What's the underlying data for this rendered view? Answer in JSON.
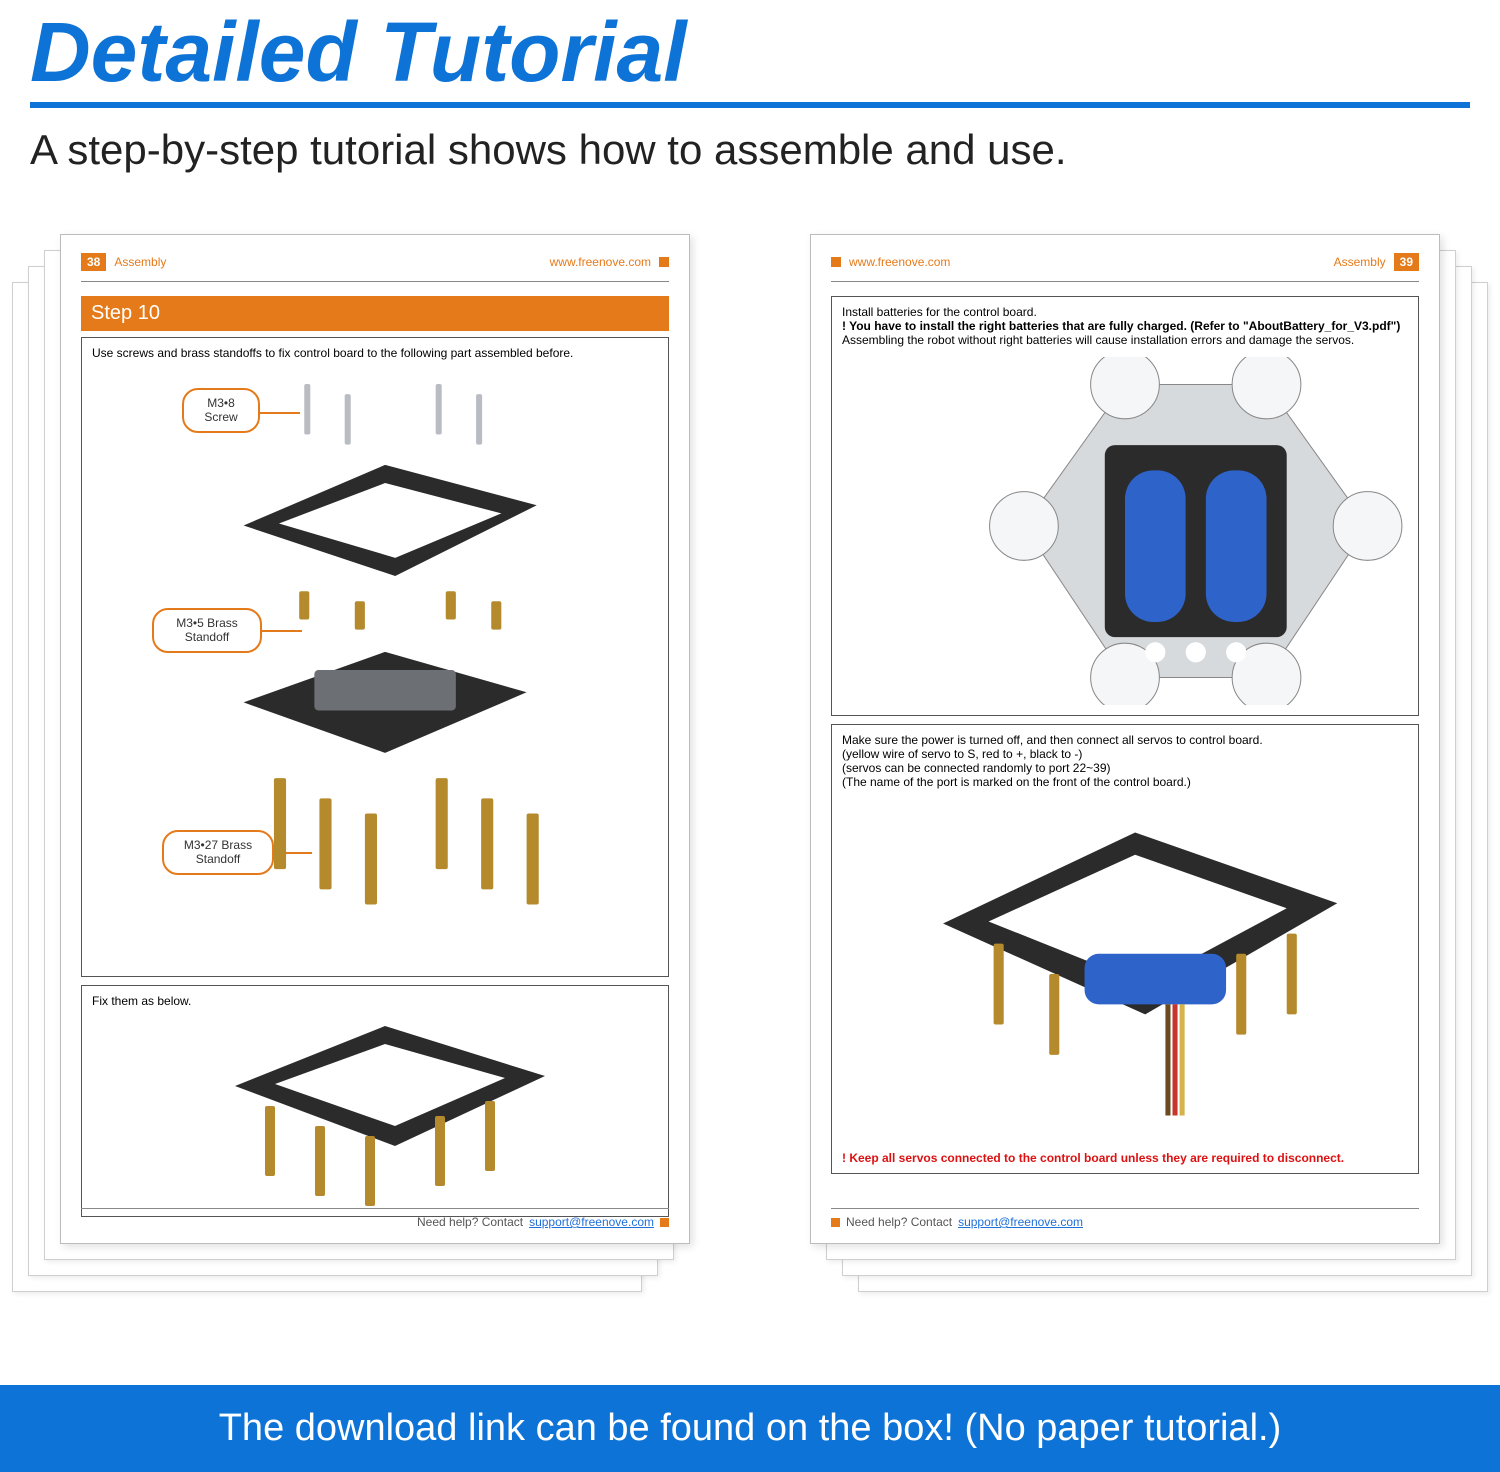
{
  "header": {
    "title": "Detailed Tutorial",
    "subtitle": "A step-by-step tutorial shows how to assemble and use."
  },
  "banner": "The download link can be found on the box! (No paper tutorial.)",
  "left": {
    "pageNum": "38",
    "section": "Assembly",
    "website": "www.freenove.com",
    "step": "Step 10",
    "intro": "Use screws and brass standoffs to fix control board to the following part assembled before.",
    "labels": {
      "m3x8": "M3•8\nScrew",
      "m3x5": "M3•5 Brass\nStandoff",
      "m3x27": "M3•27 Brass\nStandoff"
    },
    "fix": "Fix them as below."
  },
  "right": {
    "pageNum": "39",
    "section": "Assembly",
    "website": "www.freenove.com",
    "l1": "Install batteries for the control board.",
    "l2": "! You have to install the right batteries that are fully charged. (Refer to \"AboutBattery_for_V3.pdf\")",
    "l3": "Assembling the robot without right batteries will cause installation errors and damage the servos.",
    "p2a": "Make sure the power is turned off, and then connect all servos to control board.",
    "p2b": "(yellow wire of servo to S, red to +, black to -)",
    "p2c": "(servos can be connected randomly to port 22~39)",
    "p2d": "(The name of the port is marked on the front of the control board.)",
    "warn": "! Keep all servos connected to the control board unless they are required to disconnect."
  },
  "footer": {
    "need": "Need help? Contact ",
    "mail": "support@freenove.com"
  }
}
